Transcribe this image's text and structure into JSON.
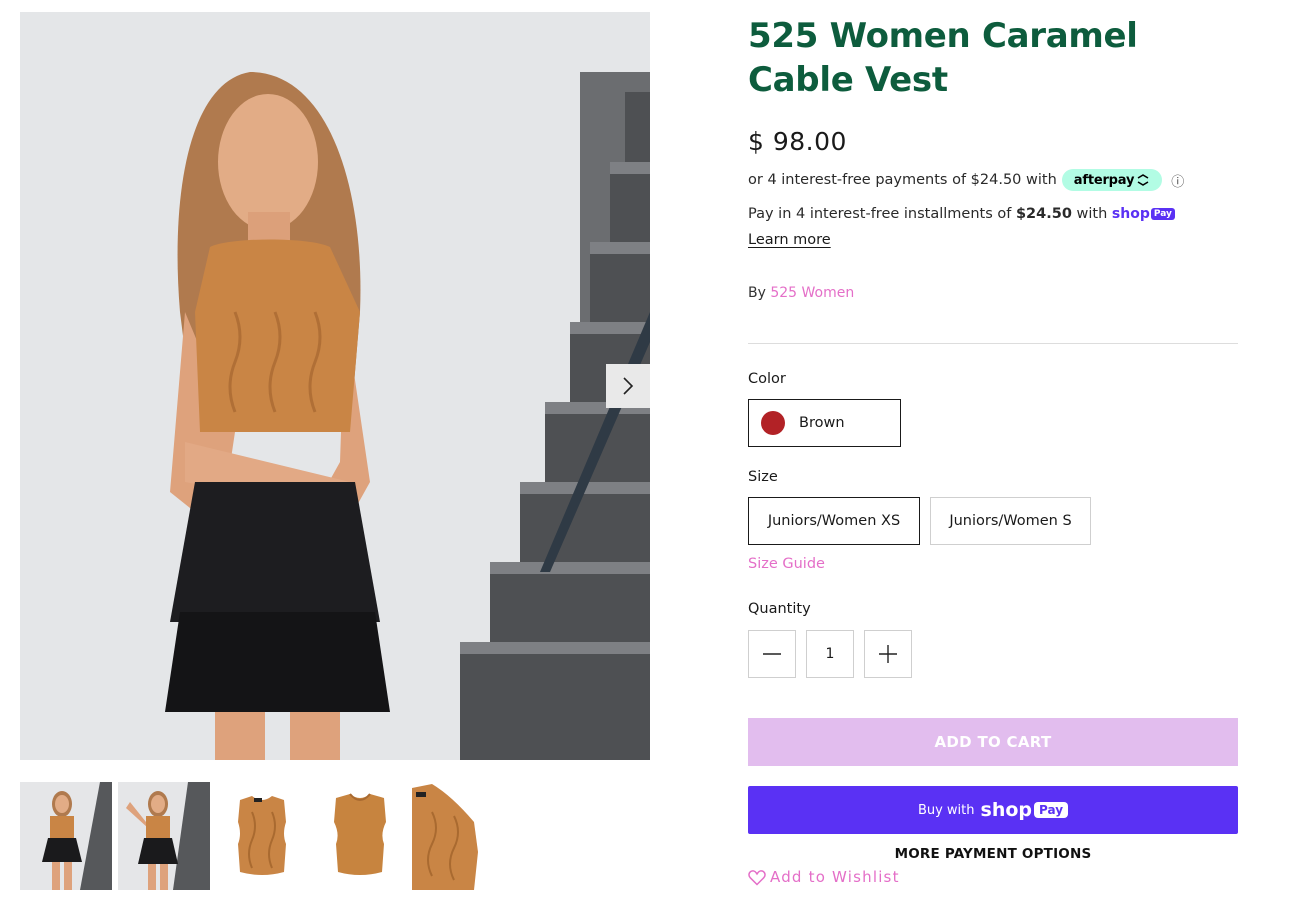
{
  "product": {
    "title": "525 Women Caramel Cable Vest",
    "price": "$ 98.00",
    "afterpay": {
      "text": "or 4 interest-free payments of $24.50 with",
      "badge": "afterpay",
      "badge_icon": "afterpay-arrows-icon",
      "info_icon": "ⓘ"
    },
    "shoppay": {
      "prefix": "Pay in 4 interest-free installments of",
      "amount": "$24.50",
      "with": "with",
      "brand": "shop",
      "brand_suffix": "Pay",
      "learn_more": "Learn more"
    },
    "by_label": "By",
    "vendor": "525 Women"
  },
  "options": {
    "color_label": "Color",
    "color_value": "Brown",
    "color_swatch": "#b22226",
    "size_label": "Size",
    "sizes": [
      "Juniors/Women XS",
      "Juniors/Women S"
    ],
    "size_guide": "Size Guide",
    "quantity_label": "Quantity",
    "quantity_value": "1"
  },
  "actions": {
    "add_to_cart": "ADD TO CART",
    "buy_with": "Buy with",
    "buy_brand": "shop",
    "buy_brand_suffix": "Pay",
    "more_payment": "MORE PAYMENT OPTIONS",
    "wishlist": "Add to Wishlist"
  },
  "colors": {
    "title_green": "#0d5c3d",
    "accent_pink": "#e46fc8",
    "add_to_cart_bg": "#e2bdee",
    "shoppay_purple": "#5a31f4",
    "afterpay_mint": "#b2fce4",
    "vest_orange": "#c98545"
  }
}
